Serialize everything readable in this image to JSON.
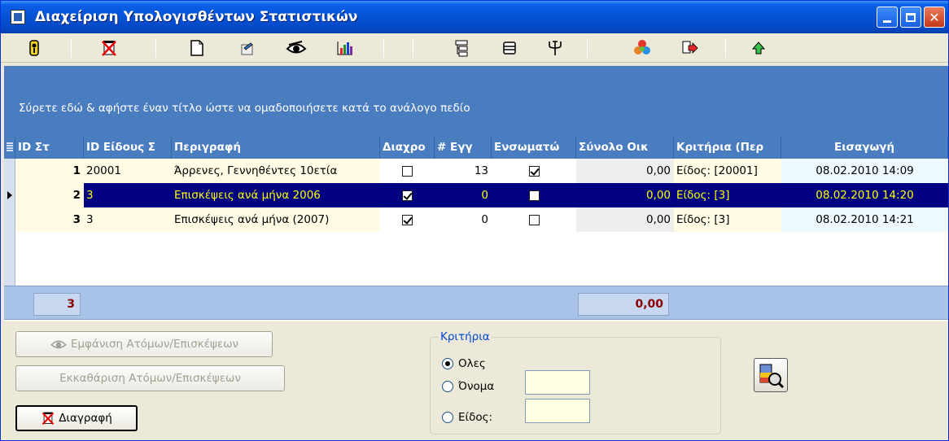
{
  "window": {
    "title": "Διαχείριση Υπολογισθέντων Στατιστικών"
  },
  "toolbar": {
    "icons": [
      "key-icon",
      "delete-icon",
      "new-document-icon",
      "edit-icon",
      "view-eye-icon",
      "chart-icon",
      "tree-icon",
      "list-icon",
      "filter-icon",
      "palette-icon",
      "export-icon",
      "up-arrow-icon"
    ]
  },
  "groupby": {
    "hint": "Σύρετε εδώ & αφήστε έναν τίτλο ώστε να ομαδοποιήσετε κατά το ανάλογο πεδίο"
  },
  "grid": {
    "columns": [
      "ID Στ",
      "ID Είδους Σ",
      "Περιγραφή",
      "Διαχρο",
      "# Εγγ",
      "Ενσωματώ",
      "Σύνολο Οικ",
      "Κριτήρια (Περ",
      "Εισαγωγή"
    ],
    "rows": [
      {
        "id": "1",
        "type_id": "20001",
        "description": "Άρρενες, Γεννηθέντες 10ετία",
        "diachr": false,
        "count": "13",
        "embedded": true,
        "total": "0,00",
        "criteria": "Είδος: [20001]",
        "inserted": "08.02.2010 14:09"
      },
      {
        "id": "2",
        "type_id": "3",
        "description": "Επισκέψεις ανά μήνα 2006",
        "diachr": true,
        "count": "0",
        "embedded": false,
        "total": "0,00",
        "criteria": "Είδος: [3]",
        "inserted": "08.02.2010 14:20"
      },
      {
        "id": "3",
        "type_id": "3",
        "description": "Επισκέψεις ανά μήνα (2007)",
        "diachr": true,
        "count": "0",
        "embedded": false,
        "total": "0,00",
        "criteria": "Είδος: [3]",
        "inserted": "08.02.2010 14:21"
      }
    ],
    "footer": {
      "count": "3",
      "total": "0,00"
    }
  },
  "buttons": {
    "show_people": "Εμφάνιση Ατόμων/Επισκέψεων",
    "clear_people": "Εκκαθάριση Ατόμων/Επισκέψεων",
    "delete": "Διαγραφή"
  },
  "criteria": {
    "legend": "Κριτήρια",
    "options": [
      "Ολες",
      "Όνομα",
      "Είδος:"
    ]
  },
  "colors": {
    "selected_row_bg": "#000080",
    "selected_row_text": "#ffff00",
    "header_bg": "#4a7dbf"
  }
}
